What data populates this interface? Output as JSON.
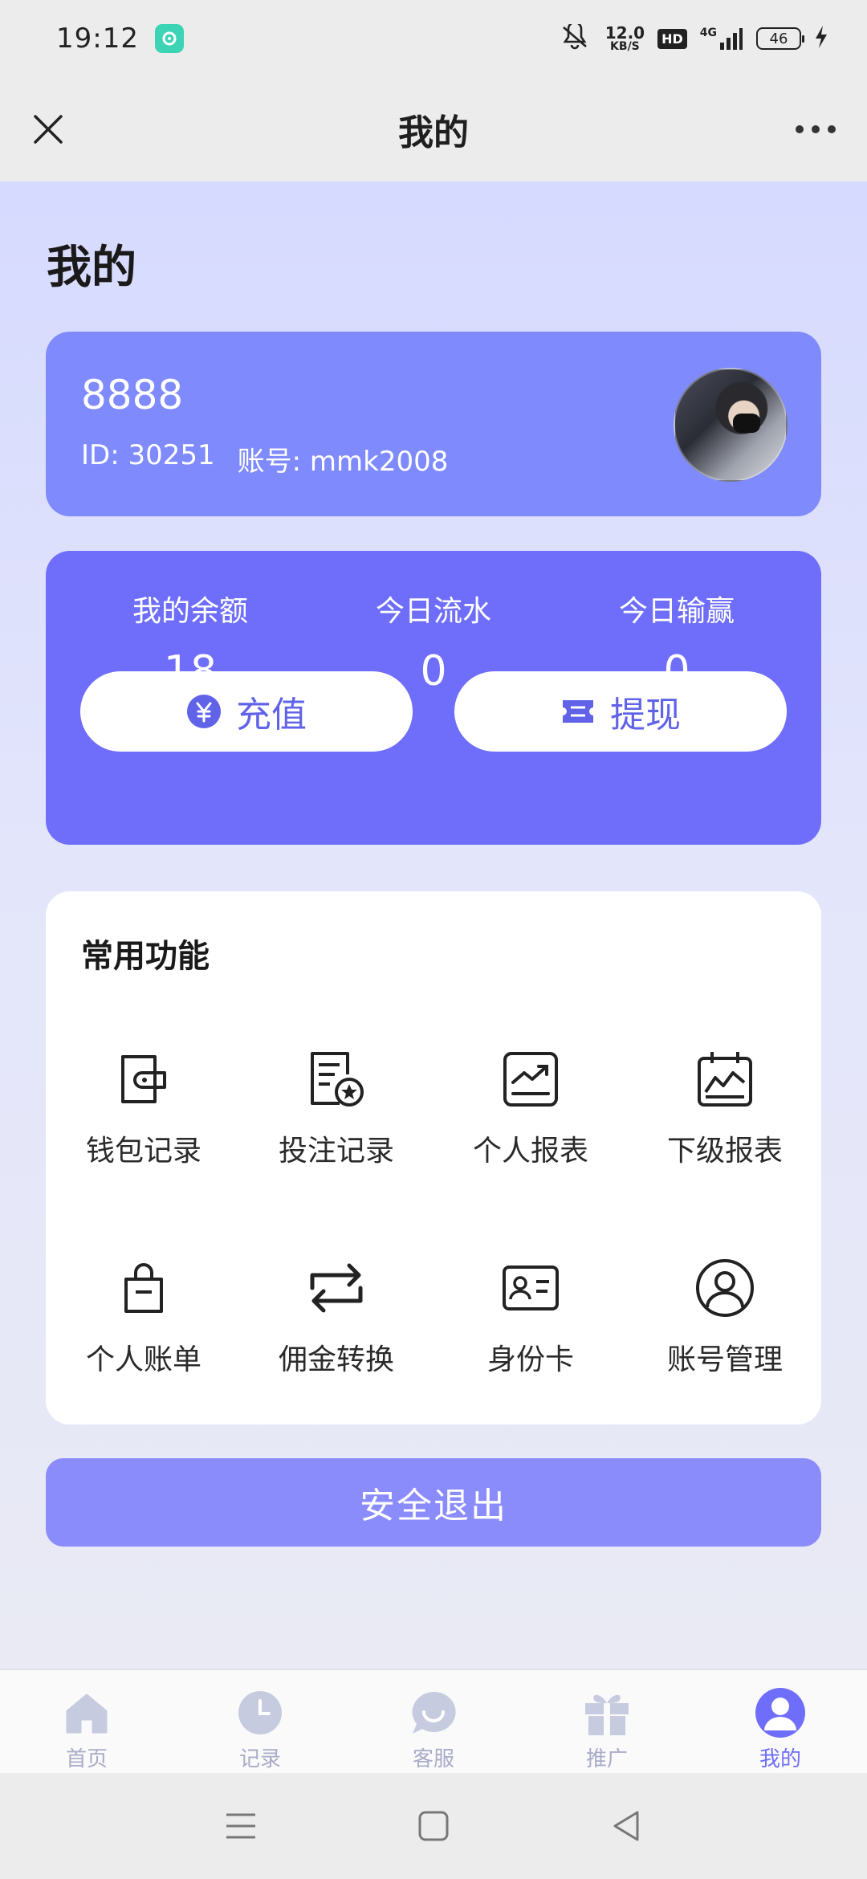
{
  "status_bar": {
    "time": "19:12",
    "speed_value": "12.0",
    "speed_unit": "KB/S",
    "hd": "HD",
    "network": "4G",
    "battery": "46"
  },
  "title_bar": {
    "title": "我的"
  },
  "page": {
    "heading": "我的"
  },
  "profile": {
    "nickname": "8888",
    "id_text": "ID:  30251",
    "account_text": "账号:  mmk2008"
  },
  "balance": {
    "stats": [
      {
        "label": "我的余额",
        "value": "18"
      },
      {
        "label": "今日流水",
        "value": "0"
      },
      {
        "label": "今日输赢",
        "value": "0"
      }
    ],
    "recharge_label": "充值",
    "withdraw_label": "提现"
  },
  "functions": {
    "title": "常用功能",
    "items": [
      {
        "label": "钱包记录",
        "icon": "wallet-icon"
      },
      {
        "label": "投注记录",
        "icon": "bet-record-icon"
      },
      {
        "label": "个人报表",
        "icon": "personal-report-icon"
      },
      {
        "label": "下级报表",
        "icon": "subordinate-report-icon"
      },
      {
        "label": "个人账单",
        "icon": "bag-icon"
      },
      {
        "label": "佣金转换",
        "icon": "exchange-icon"
      },
      {
        "label": "身份卡",
        "icon": "id-card-icon"
      },
      {
        "label": "账号管理",
        "icon": "user-circle-icon"
      }
    ]
  },
  "logout_label": "安全退出",
  "tabs": [
    {
      "label": "首页",
      "icon": "home-icon"
    },
    {
      "label": "记录",
      "icon": "clock-icon"
    },
    {
      "label": "客服",
      "icon": "chat-icon"
    },
    {
      "label": "推广",
      "icon": "gift-icon"
    },
    {
      "label": "我的",
      "icon": "user-icon",
      "active": true
    }
  ],
  "colors": {
    "accent": "#6f6efa",
    "profile_card": "#7f8bfd",
    "logout": "#8b8cfb",
    "tab_inactive": "#a8acc7"
  }
}
